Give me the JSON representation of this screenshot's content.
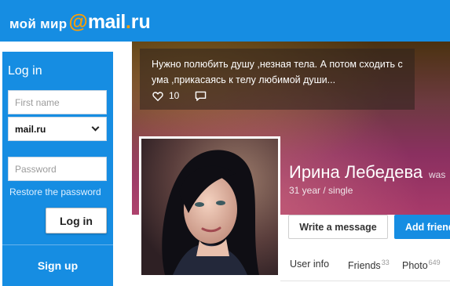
{
  "header": {
    "logo_word": "мой мир",
    "logo_at": "@",
    "logo_mail": "mail",
    "logo_dot": ".",
    "logo_ru": "ru"
  },
  "login": {
    "title": "Log in",
    "first_name_placeholder": "First name",
    "domain_value": "mail.ru",
    "password_placeholder": "Password",
    "restore_link": "Restore the password",
    "login_button": "Log in",
    "signup_button": "Sign up"
  },
  "status": {
    "text": "Нужно полюбить душу ,незная тела. А потом сходить с ума ,прикасаясь к телу любимой души...",
    "likes": "10",
    "icons": {
      "like": "heart-icon",
      "comment": "comment-icon"
    }
  },
  "profile": {
    "name": "Ирина Лебедева",
    "was_online": "was",
    "meta": "31 year / single"
  },
  "actions": {
    "write_message": "Write a message",
    "add_friend": "Add friend"
  },
  "tabs": {
    "user_info": "User info",
    "friends": "Friends",
    "friends_count": "33",
    "photo": "Photo",
    "photo_count": "649"
  },
  "colors": {
    "brand_blue": "#168de2",
    "logo_accent": "#ff9e00"
  }
}
